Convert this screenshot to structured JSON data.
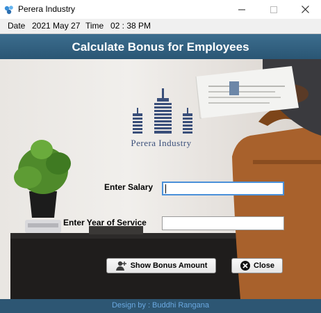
{
  "window": {
    "title": "Perera Industry",
    "controls": {
      "minimize": "minimize",
      "maximize": "maximize",
      "close": "close"
    }
  },
  "infobar": {
    "date_label": "Date",
    "date_value": "2021 May 27",
    "time_label": "Time",
    "time_value": "02 : 38 PM"
  },
  "header": {
    "title": "Calculate Bonus for Employees"
  },
  "logo": {
    "text": "Perera Industry",
    "color": "#3a4f7a"
  },
  "form": {
    "salary_label": "Enter Salary",
    "salary_value": "",
    "years_label": "Enter Year of  Service",
    "years_value": ""
  },
  "buttons": {
    "show_bonus": "Show Bonus Amount",
    "close": "Close"
  },
  "footer": {
    "text": "Design by : Buddhi Rangana"
  },
  "colors": {
    "header_band": "#2f5c7a",
    "footer_band": "#2d5673",
    "footer_text": "#6aa8e0",
    "focus_border": "#4a90d9"
  },
  "icons": {
    "app": "app-icon",
    "minimize": "minimize-icon",
    "maximize": "maximize-icon",
    "close": "close-icon",
    "bonus": "user-add-icon",
    "close_button": "close-circle-icon"
  }
}
